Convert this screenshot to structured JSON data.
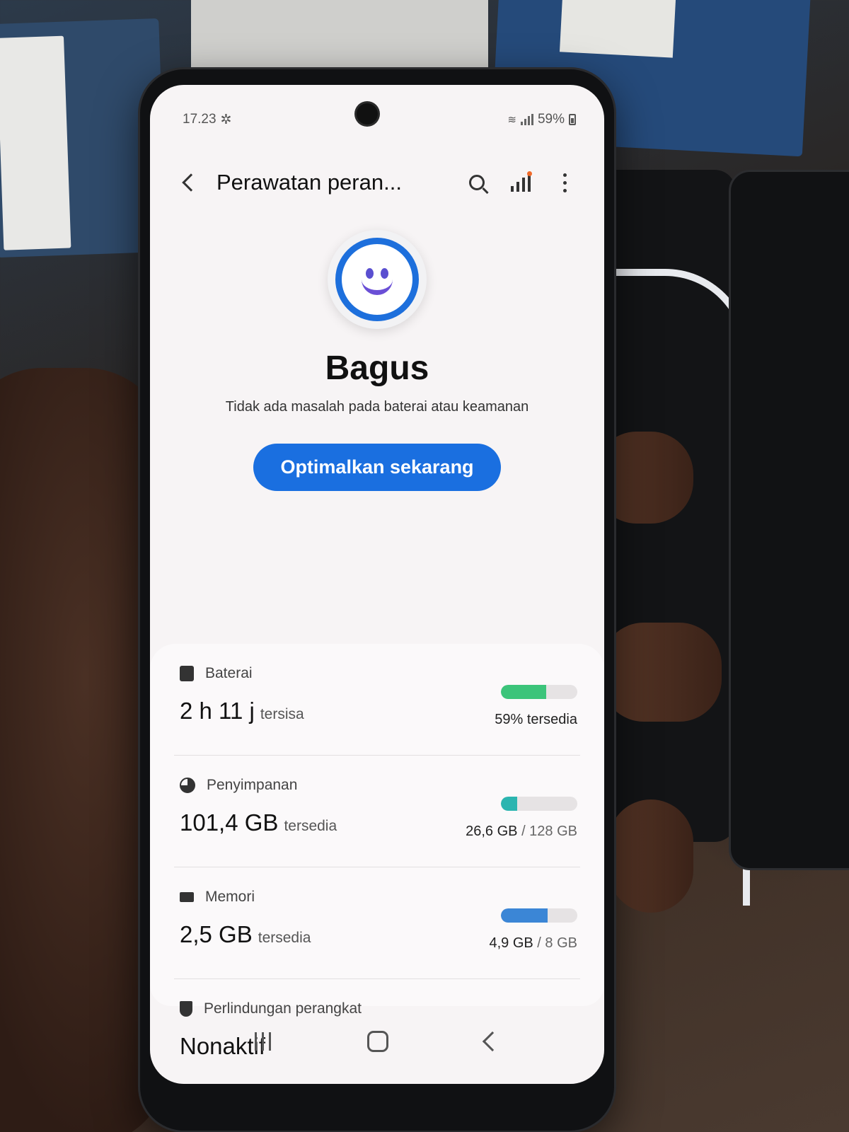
{
  "status_bar": {
    "time": "17.23",
    "battery_percent": "59%"
  },
  "app_bar": {
    "title": "Perawatan peran..."
  },
  "hero": {
    "status_title": "Bagus",
    "status_subtitle": "Tidak ada masalah pada baterai atau keamanan",
    "optimize_button": "Optimalkan sekarang"
  },
  "items": {
    "battery": {
      "label": "Baterai",
      "value": "2 h 11 j",
      "value_suffix": "tersisa",
      "meter_text": "59% tersedia",
      "meter_fraction": 0.59,
      "meter_color": "#3cc47a"
    },
    "storage": {
      "label": "Penyimpanan",
      "value": "101,4 GB",
      "value_suffix": "tersedia",
      "used": "26,6 GB",
      "total": "/ 128 GB",
      "meter_fraction": 0.21,
      "meter_color": "#2bb5b0"
    },
    "memory": {
      "label": "Memori",
      "value": "2,5 GB",
      "value_suffix": "tersedia",
      "used": "4,9 GB",
      "total": "/ 8 GB",
      "meter_fraction": 0.61,
      "meter_color": "#3b86d6"
    },
    "protection": {
      "label": "Perlindungan perangkat",
      "value": "Nonaktif"
    }
  },
  "colors": {
    "accent": "#1a6fe0"
  }
}
